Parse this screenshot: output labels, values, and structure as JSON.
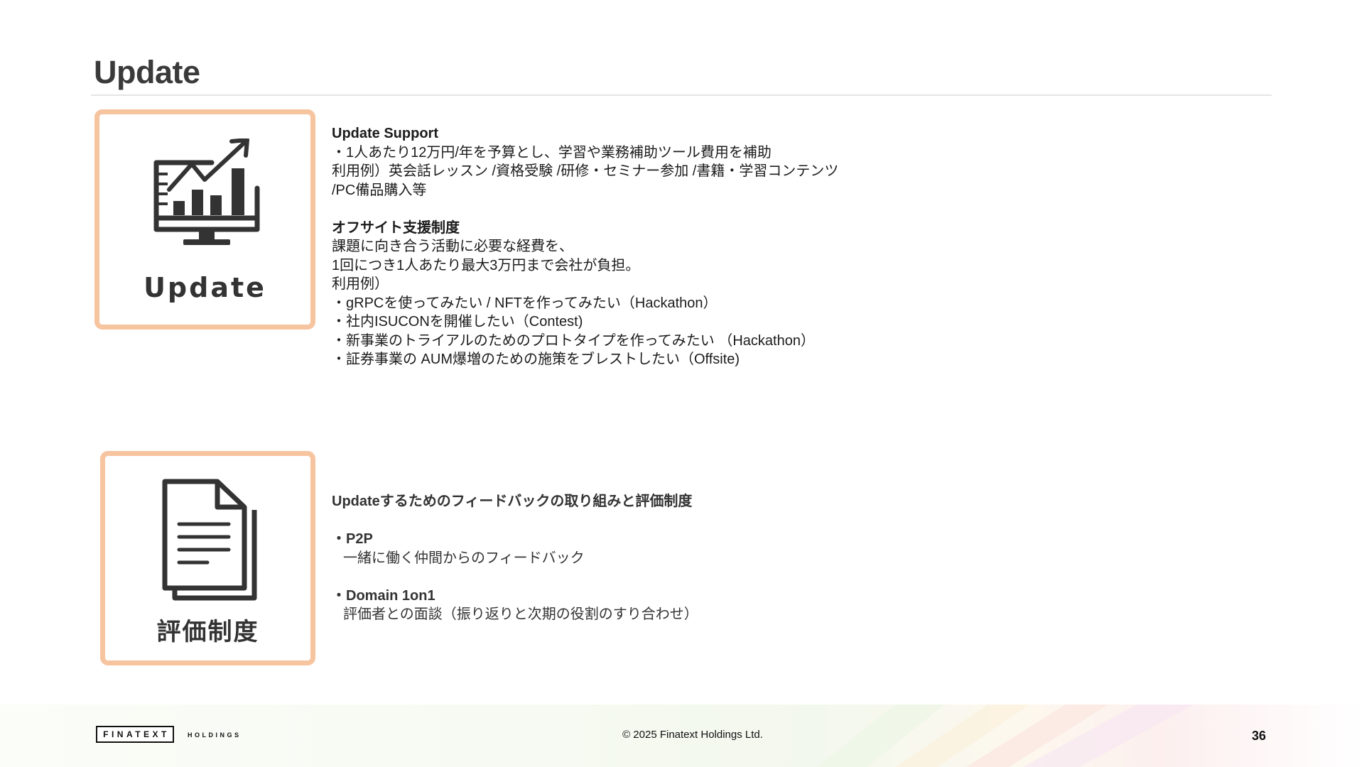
{
  "page": {
    "title": "Update",
    "page_number": "36"
  },
  "cards": {
    "update": {
      "label": "Update",
      "icon": "monitor-chart-icon"
    },
    "evaluation": {
      "label": "評価制度",
      "icon": "document-icon"
    }
  },
  "support": {
    "heading": "Update Support",
    "lines": [
      "・1人あたり12万円/年を予算とし、学習や業務補助ツール費用を補助",
      "利用例）英会話レッスン /資格受験 /研修・セミナー参加 /書籍・学習コンテンツ",
      "/PC備品購入等"
    ]
  },
  "offsite": {
    "heading": "オフサイト支援制度",
    "lines": [
      "課題に向き合う活動に必要な経費を、",
      "1回につき1人あたり最大3万円まで会社が負担。",
      "利用例）",
      "・gRPCを使ってみたい  / NFTを作ってみたい（Hackathon）",
      "・社内ISUCONを開催したい（Contest)",
      "・新事業のトライアルのためのプロトタイプを作ってみたい （Hackathon）",
      "・証券事業の AUM爆増のための施策をブレストしたい（Offsite)"
    ]
  },
  "feedback": {
    "heading": "Updateするためのフィードバックの取り組みと評価制度",
    "items": [
      {
        "title": "・P2P",
        "desc": "一緒に働く仲間からのフィードバック"
      },
      {
        "title": "・Domain 1on1",
        "desc": "評価者との面談（振り返りと次期の役割のすり合わせ）"
      }
    ]
  },
  "footer": {
    "logo_main": "FINATEXT",
    "logo_sub": "HOLDINGS",
    "copyright": "© 2025 Finatext Holdings Ltd."
  },
  "colors": {
    "card_border": "#f7c4a0",
    "icon": "#333333",
    "title": "#3a3a3a"
  }
}
